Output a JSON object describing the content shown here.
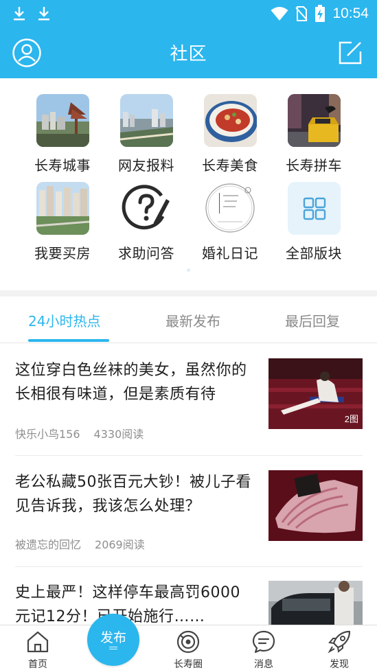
{
  "status_bar": {
    "time": "10:54",
    "icons": [
      "download-icon",
      "download-icon",
      "wifi-icon",
      "no-sim-icon",
      "battery-charging-icon"
    ]
  },
  "header": {
    "title": "社区",
    "left_icon": "avatar-icon",
    "right_icon": "edit-icon"
  },
  "categories": [
    {
      "label": "长寿城事",
      "icon": "city-photo"
    },
    {
      "label": "网友报料",
      "icon": "city-aerial-photo"
    },
    {
      "label": "长寿美食",
      "icon": "food-bowl-photo"
    },
    {
      "label": "长寿拼车",
      "icon": "taxi-photo"
    },
    {
      "label": "我要买房",
      "icon": "apartments-photo"
    },
    {
      "label": "求助问答",
      "icon": "question-pen-icon"
    },
    {
      "label": "婚礼日记",
      "icon": "wedding-diary-logo"
    },
    {
      "label": "全部版块",
      "icon": "grid-icon"
    }
  ],
  "tabs": [
    {
      "label": "24小时热点",
      "active": true
    },
    {
      "label": "最新发布",
      "active": false
    },
    {
      "label": "最后回复",
      "active": false
    }
  ],
  "posts": [
    {
      "title": "这位穿白色丝袜的美女，虽然你的长相很有味道，但是素质有待",
      "author": "快乐小鸟156",
      "reads": "4330阅读",
      "image_badge": "2图"
    },
    {
      "title": "老公私藏50张百元大钞！被儿子看见告诉我，我该怎么处理？",
      "author": "被遗忘的回忆",
      "reads": "2069阅读",
      "image_badge": ""
    },
    {
      "title": "史上最严！这样停车最高罚6000元记12分！已开始施行……",
      "author": "",
      "reads": "",
      "image_badge": ""
    }
  ],
  "bottom_nav": {
    "items": [
      {
        "label": "首页",
        "icon": "home-icon"
      },
      {
        "label": "长寿圈",
        "icon": "circle-icon"
      },
      {
        "label": "消息",
        "icon": "message-icon"
      },
      {
        "label": "发现",
        "icon": "rocket-icon"
      }
    ],
    "publish_label": "发布"
  },
  "colors": {
    "brand": "#2bb6ee",
    "text": "#1e1e1e",
    "muted": "#8e8e8e"
  }
}
